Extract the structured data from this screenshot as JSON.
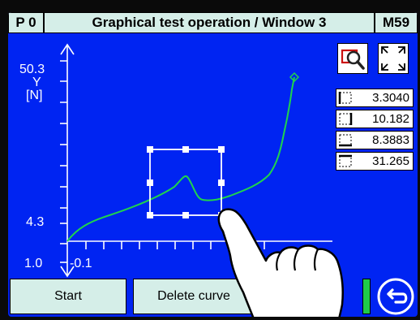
{
  "header": {
    "program": "P 0",
    "title": "Graphical test operation / Window 3",
    "code": "M59"
  },
  "axis": {
    "y_max": "50.3",
    "y_name": "Y",
    "y_unit": "[N]",
    "y_mid": "4.3",
    "y_min": "1.0",
    "x_min": "-0.1"
  },
  "values": {
    "v1": "3.3040",
    "v2": "10.182",
    "v3": "8.3883",
    "v4": "31.265"
  },
  "buttons": {
    "start": "Start",
    "delete": "Delete curve"
  },
  "icons": {
    "zoom": "zoom-select-icon",
    "fit": "fit-screen-icon",
    "back": "back-icon",
    "hand": "hand-pointer-icon"
  },
  "colors": {
    "background": "#0024f2",
    "curve": "#1fd34d",
    "header": "#d5eee8",
    "accent_red": "#cc1111"
  }
}
